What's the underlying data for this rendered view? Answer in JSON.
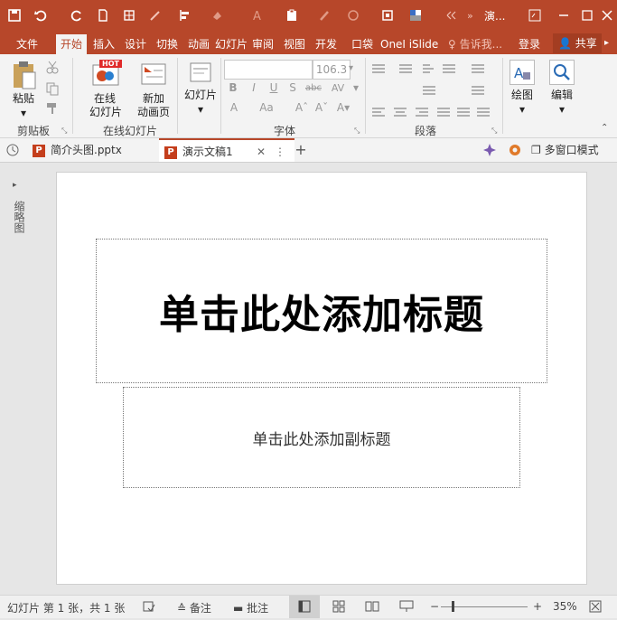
{
  "title_bar": {
    "title": "演...",
    "autosave_icon": "save-icon"
  },
  "tabs": [
    {
      "label": "文件"
    },
    {
      "label": "开始"
    },
    {
      "label": "插入"
    },
    {
      "label": "设计"
    },
    {
      "label": "切换"
    },
    {
      "label": "动画"
    },
    {
      "label": "幻灯片"
    },
    {
      "label": "审阅"
    },
    {
      "label": "视图"
    },
    {
      "label": "开发"
    },
    {
      "label": "口袋"
    },
    {
      "label": "OneI"
    },
    {
      "label": "iSlide"
    }
  ],
  "tell_me": "告诉我...",
  "login": "登录",
  "share": "共享",
  "ribbon": {
    "clipboard": {
      "paste": "粘贴",
      "group": "剪贴板"
    },
    "online_slides": {
      "online": "在线",
      "online2": "幻灯片",
      "hot": "HOT",
      "new_anim": "新加",
      "new_anim2": "动画页",
      "group": "在线幻灯片"
    },
    "slides": {
      "label": "幻灯片"
    },
    "font": {
      "size": "106.3",
      "group": "字体",
      "bold": "B",
      "italic": "I",
      "underline": "U",
      "strike": "S",
      "abc": "abc",
      "av": "AV",
      "a_big": "A",
      "aa": "Aa"
    },
    "paragraph": {
      "group": "段落"
    },
    "drawing": {
      "label": "绘图"
    },
    "editing": {
      "label": "编辑"
    }
  },
  "doc_tabs": [
    {
      "label": "简介头图.pptx"
    },
    {
      "label": "演示文稿1"
    }
  ],
  "multi_window": "多窗口模式",
  "side_panel": "缩略图",
  "slide": {
    "title_placeholder": "单击此处添加标题",
    "subtitle_placeholder": "单击此处添加副标题"
  },
  "status": {
    "slide_info": "幻灯片 第 1 张，共 1 张",
    "notes": "备注",
    "comments": "批注",
    "zoom": "35%"
  },
  "colors": {
    "accent": "#b7472a",
    "ribbon_bg": "#f3f3f3"
  }
}
